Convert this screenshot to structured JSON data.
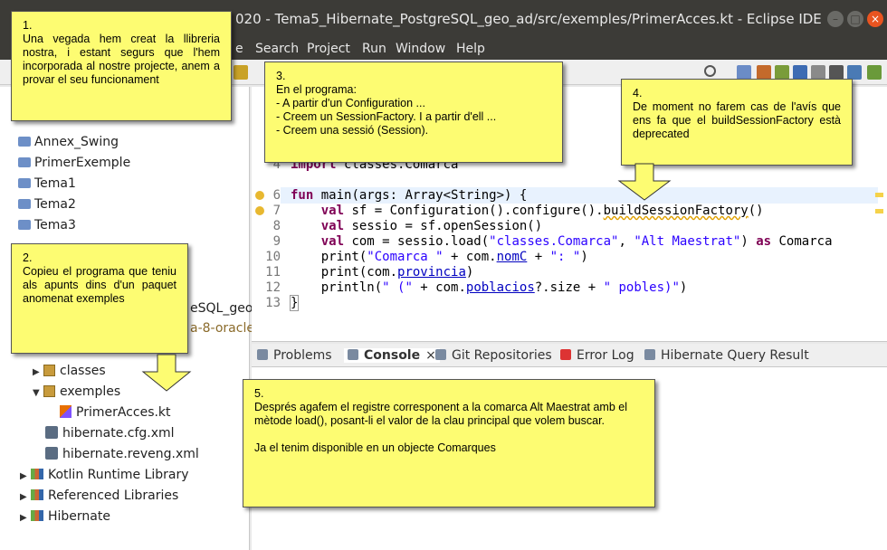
{
  "window": {
    "title": "020 - Tema5_Hibernate_PostgreSQL_geo_ad/src/exemples/PrimerAcces.kt - Eclipse IDE",
    "buttons": [
      "–",
      "□",
      "×"
    ]
  },
  "menubar": [
    "e",
    "Search",
    "Project",
    "Run",
    "Window",
    "Help"
  ],
  "explorer": {
    "items": [
      {
        "label": "Annex_Swing",
        "icon": "project-folder-icon"
      },
      {
        "label": "PrimerExemple",
        "icon": "project-folder-icon"
      },
      {
        "label": "Tema1",
        "icon": "project-folder-icon"
      },
      {
        "label": "Tema2",
        "icon": "project-folder-icon"
      },
      {
        "label": "Tema3",
        "icon": "project-folder-icon"
      }
    ],
    "partial_project": "eSQL_geo",
    "partial_lib": "a-8-oracle",
    "src_items": [
      {
        "label": "classes",
        "icon": "package-icon"
      },
      {
        "label": "exemples",
        "icon": "package-icon"
      },
      {
        "label": "PrimerAcces.kt",
        "icon": "kotlin-file-icon"
      },
      {
        "label": "hibernate.cfg.xml",
        "icon": "xml-file-icon"
      },
      {
        "label": "hibernate.reveng.xml",
        "icon": "xml-file-icon"
      },
      {
        "label": "Kotlin Runtime Library",
        "icon": "library-icon"
      },
      {
        "label": "Referenced Libraries",
        "icon": "library-icon"
      },
      {
        "label": "Hibernate",
        "icon": "library-icon"
      }
    ]
  },
  "editor": {
    "line_numbers": [
      "4",
      "6",
      "7",
      "8",
      "9",
      "10",
      "11",
      "12",
      "13"
    ],
    "lines": {
      "l4_kw": "import",
      "l4_rest": " classes.Comarca",
      "l6_kw": "fun",
      "l6_rest": " main(args: Array<String>) {",
      "l7_kw": "val",
      "l7_a": " sf = Configuration().configure().",
      "l7_warn": "buildSessionFactory",
      "l7_b": "()",
      "l8_kw": "val",
      "l8_rest": " sessio = sf.openSession()",
      "l9_kw": "val",
      "l9_a": " com = sessio.load(",
      "l9_s1": "\"classes.Comarca\"",
      "l9_b": ", ",
      "l9_s2": "\"Alt Maestrat\"",
      "l9_c": ") ",
      "l9_kw2": "as",
      "l9_d": " Comarca",
      "l10_a": "print(",
      "l10_s1": "\"Comarca \"",
      "l10_b": " + com.",
      "l10_p": "nomC",
      "l10_c": " + ",
      "l10_s2": "\": \"",
      "l10_d": ")",
      "l11_a": "print(com.",
      "l11_p": "provincia",
      "l11_b": ")",
      "l12_a": "println(",
      "l12_s1": "\" (\"",
      "l12_b": " + com.",
      "l12_p": "poblacios",
      "l12_c": "?.size + ",
      "l12_s2": "\" pobles)\"",
      "l12_d": ")",
      "l13": "}"
    }
  },
  "panel_tabs": [
    "Problems",
    "Console",
    "Git Repositories",
    "Error Log",
    "Hibernate Query Result"
  ],
  "notes": {
    "n1": "1.\nUna vegada hem creat la llibreria nostra, i estant segurs que l'hem incorporada al nostre projecte, anem a provar el seu funcionament",
    "n2": "2.\nCopieu el programa que teniu als apunts dins d'un paquet anomenat exemples",
    "n3": "3.\nEn el programa:\n- A partir d'un Configuration ...\n- Creem un SessionFactory. I a partir d'ell ...\n- Creem una sessió (Session).",
    "n4": "4.\nDe moment no farem cas de l'avís que ens fa que el buildSessionFactory està deprecated",
    "n5": "5.\nDesprés agafem el registre corresponent a la comarca Alt Maestrat amb el mètode load(), posant-li el valor  de la clau principal que volem buscar.\n\nJa el tenim disponible en un objecte Comarques"
  },
  "colors": {
    "note": "#fdfc72",
    "keyword": "#7f0055",
    "string": "#2a00ff",
    "titlebar": "#3c3b37"
  }
}
